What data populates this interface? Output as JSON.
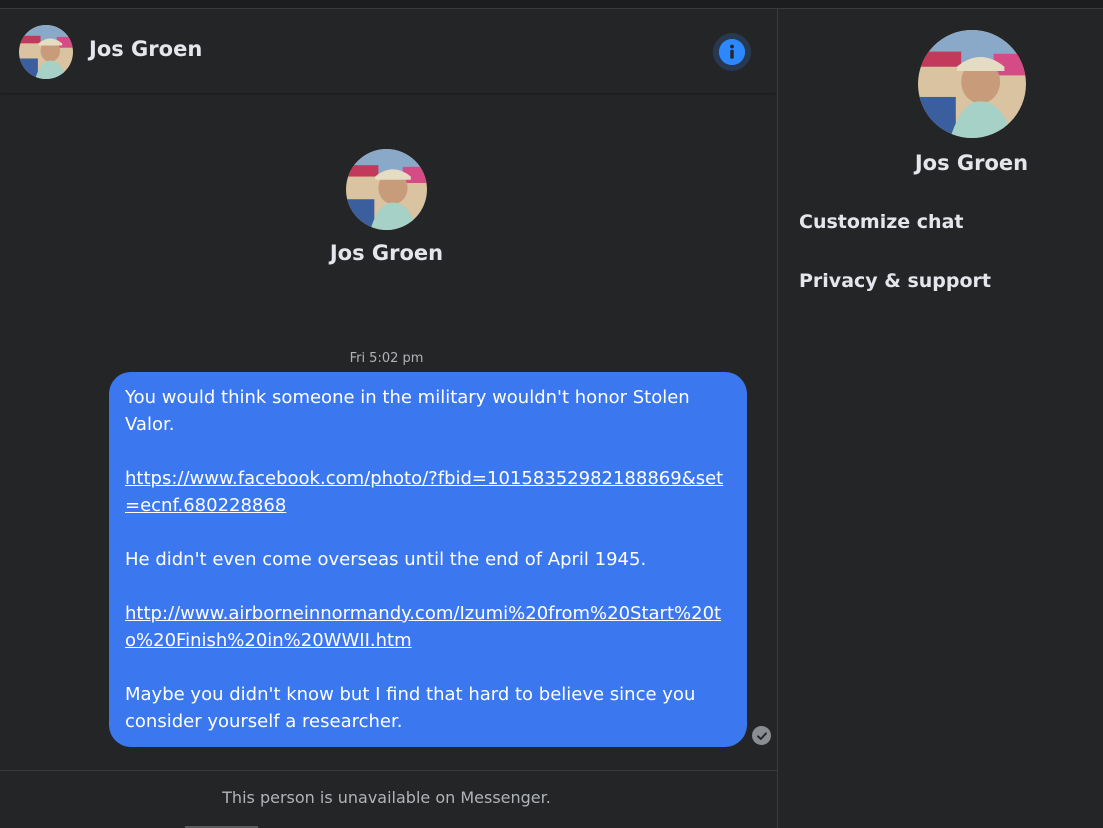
{
  "contact": {
    "name": "Jos Groen"
  },
  "header": {
    "name": "Jos Groen",
    "info_icon": "info-icon"
  },
  "profile": {
    "name": "Jos Groen"
  },
  "conversation": {
    "timestamp": "Fri 5:02 pm",
    "message": {
      "line1": "You would think someone in the military wouldn't honor Stolen Valor.",
      "link1": "https://www.facebook.com/photo/?fbid=10158352982188869&set=ecnf.680228868",
      "line2": "He didn't even come overseas until the end of April 1945.",
      "link2": "http://www.airborneinnormandy.com/Izumi%20from%20Start%20to%20Finish%20in%20WWII.htm",
      "line3": "Maybe you didn't know but I find that hard to believe since you consider yourself a researcher."
    },
    "status_icon": "seen-check-icon"
  },
  "footer": {
    "text": "This person is unavailable on Messenger."
  },
  "side_panel": {
    "name": "Jos Groen",
    "items": [
      {
        "label": "Customize chat"
      },
      {
        "label": "Privacy & support"
      }
    ]
  },
  "colors": {
    "background": "#242526",
    "bubble": "#3b78f0",
    "accent": "#2d88ff",
    "text_primary": "#e4e6eb",
    "text_secondary": "#b0b3b8"
  }
}
